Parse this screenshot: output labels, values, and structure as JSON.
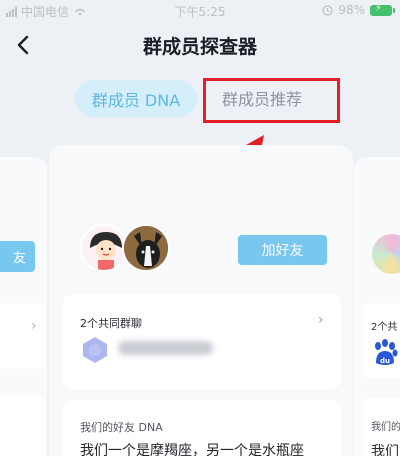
{
  "status_bar": {
    "carrier": "中国电信",
    "time": "下午5:25",
    "battery": "98%"
  },
  "header": {
    "title": "群成员探查器",
    "back_icon": "chevron-left-icon"
  },
  "tabs": {
    "dna_label": "群成员 DNA",
    "recommend_label": "群成员推荐"
  },
  "annotation": {
    "box_color": "#e31e24",
    "arrow_color": "#e31e24"
  },
  "left_card": {
    "add_friend_partial": "友"
  },
  "main_card": {
    "add_friend_label": "加好友",
    "common_groups_title": "2个共同群聊",
    "friend_dna_label": "我们的好友 DNA",
    "friend_dna_text": "我们一个是摩羯座，另一个是水瓶座"
  },
  "right_card": {
    "common_groups_partial": "2个共",
    "friend_label_partial": "我们的",
    "friend_text_partial": "我们"
  },
  "colors": {
    "accent_blue": "#78c7ee",
    "tab_active_bg": "#d4eefa",
    "tab_active_text": "#5fb7e2"
  }
}
